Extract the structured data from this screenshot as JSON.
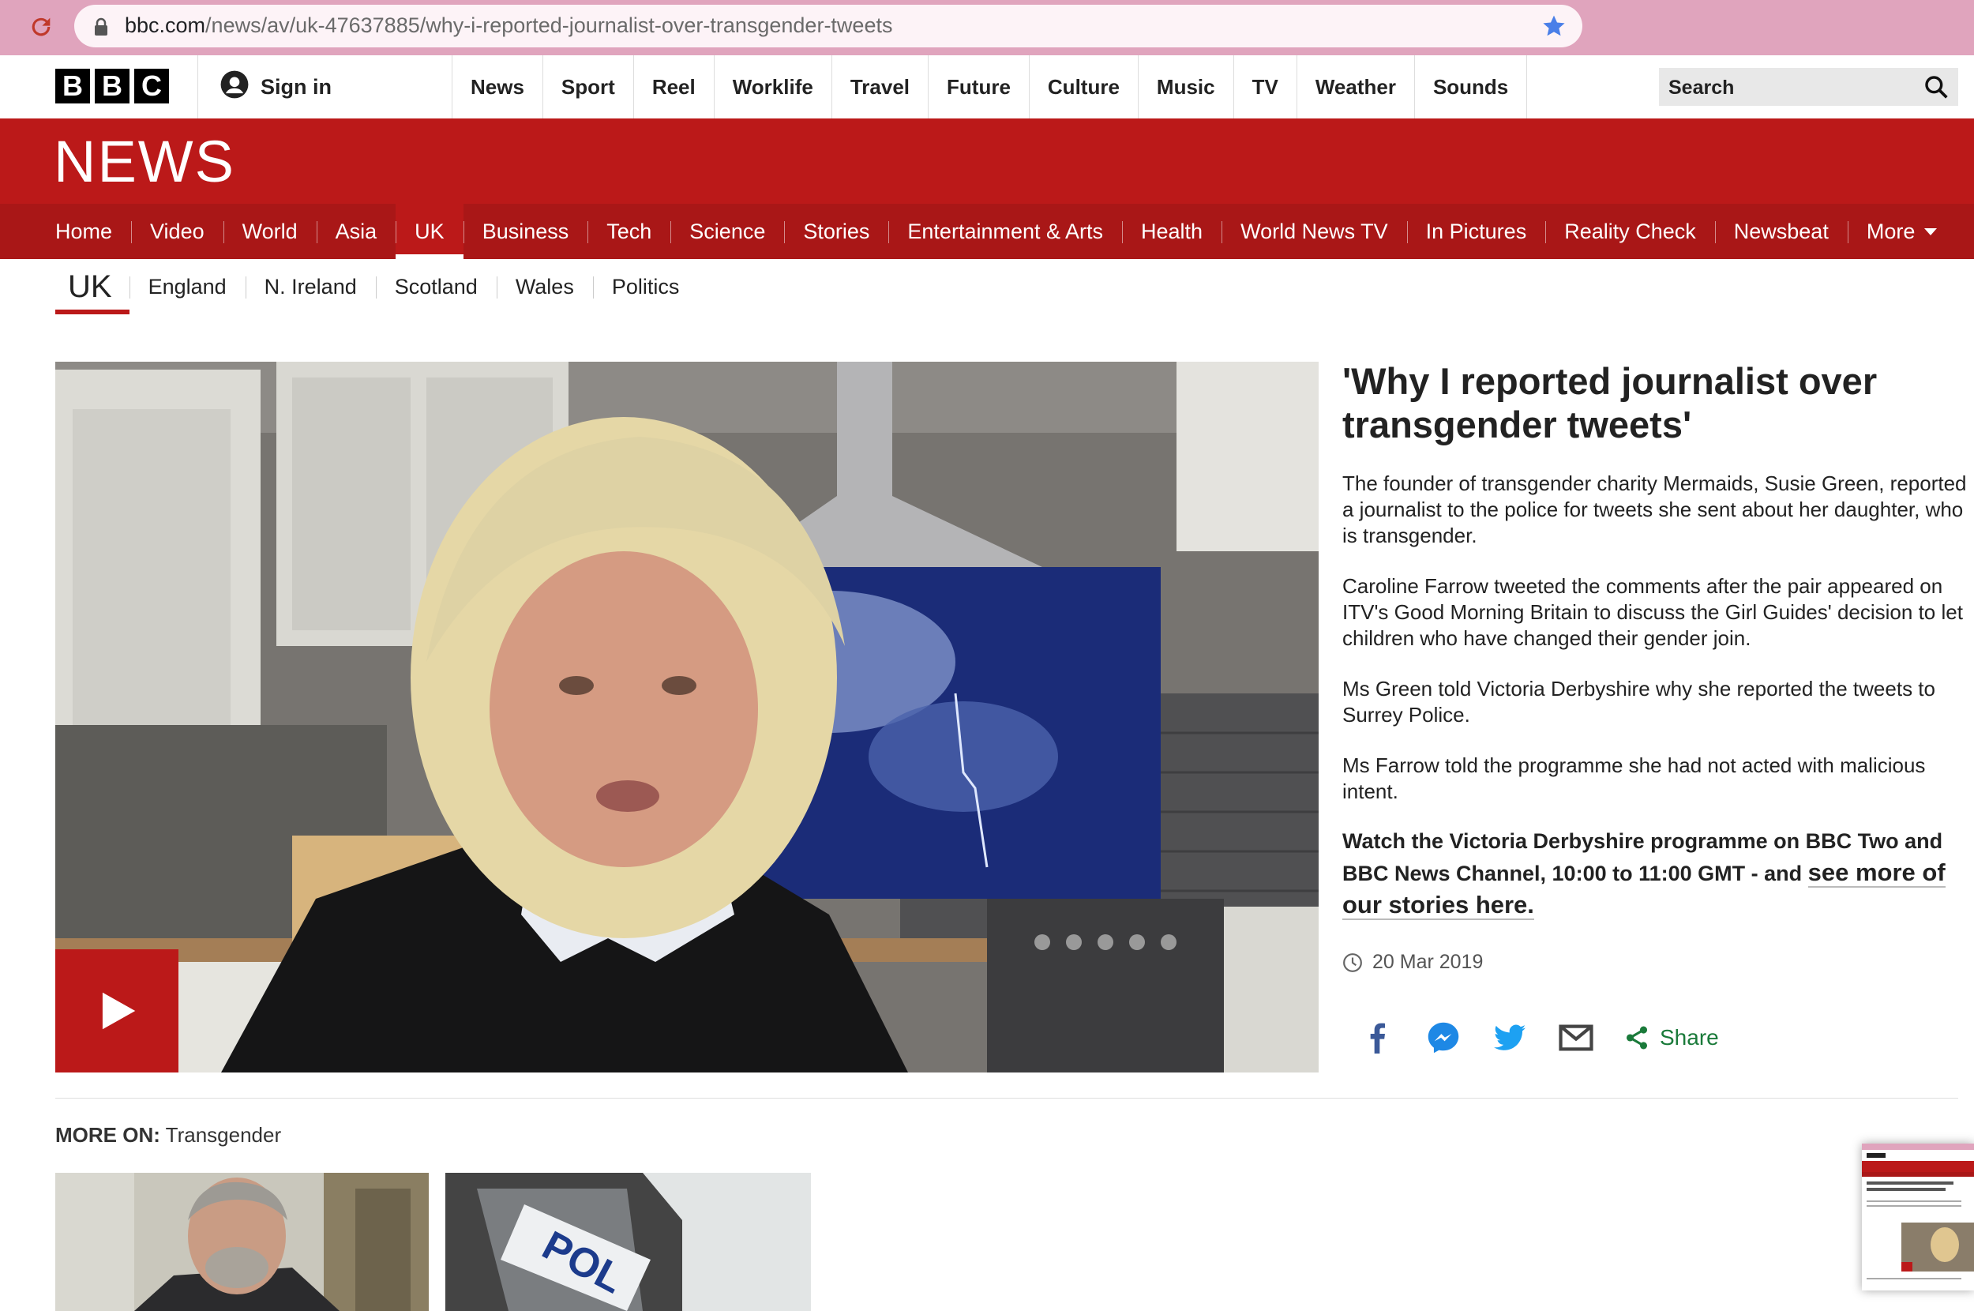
{
  "browser": {
    "url_host": "bbc.com",
    "url_path": "/news/av/uk-47637885/why-i-reported-journalist-over-transgender-tweets"
  },
  "topbar": {
    "logo": [
      "B",
      "B",
      "C"
    ],
    "signin": "Sign in",
    "nav": [
      "News",
      "Sport",
      "Reel",
      "Worklife",
      "Travel",
      "Future",
      "Culture",
      "Music",
      "TV",
      "Weather",
      "Sounds"
    ],
    "search_label": "Search"
  },
  "news": {
    "title": "NEWS",
    "sections": [
      "Home",
      "Video",
      "World",
      "Asia",
      "UK",
      "Business",
      "Tech",
      "Science",
      "Stories",
      "Entertainment & Arts",
      "Health",
      "World News TV",
      "In Pictures",
      "Reality Check",
      "Newsbeat",
      "More"
    ],
    "active_section": "UK"
  },
  "subnav": {
    "current": "UK",
    "items": [
      "England",
      "N. Ireland",
      "Scotland",
      "Wales",
      "Politics"
    ]
  },
  "article": {
    "headline": "'Why I reported journalist over transgender tweets'",
    "paragraphs": [
      "The founder of transgender charity Mermaids, Susie Green, reported a journalist to the police for tweets she sent about her daughter, who is transgender.",
      "Caroline Farrow tweeted the comments after the pair appeared on ITV's Good Morning Britain to discuss the Girl Guides' decision to let children who have changed their gender join.",
      "Ms Green told Victoria Derbyshire why she reported the tweets to Surrey Police.",
      "Ms Farrow told the programme she had not acted with malicious intent."
    ],
    "watch_text": "Watch the Victoria Derbyshire programme on BBC Two and BBC News Channel, 10:00 to 11:00 GMT - and ",
    "watch_link": "see more of our stories here.",
    "date": "20 Mar 2019",
    "share_label": "Share"
  },
  "more_on": {
    "label": "MORE ON:",
    "topic": "Transgender"
  },
  "colors": {
    "bbc_red": "#bb1919",
    "section_red": "#a91717",
    "share_green": "#1a7a3a",
    "twitter_blue": "#1da1f2",
    "facebook_blue": "#3b5998"
  },
  "icons": [
    "reload-icon",
    "lock-icon",
    "bookmark-star-icon",
    "user-icon",
    "search-icon",
    "play-icon",
    "clock-icon",
    "facebook-icon",
    "messenger-icon",
    "twitter-icon",
    "email-icon",
    "share-icon"
  ]
}
